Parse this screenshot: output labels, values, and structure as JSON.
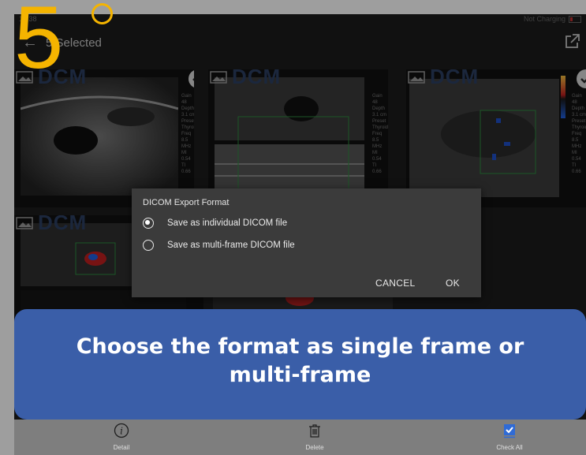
{
  "status": {
    "time": "10:38",
    "battery_text": "Not Charging"
  },
  "header": {
    "selected_label": "5 Selected"
  },
  "thumbnails": {
    "watermark": "DCM",
    "side_info": "Gain\n48\nDepth\n3.1 cm\nPreset\nThyroid\nFreq\n8.5\nMHz\nMI\n0.54\nTI\n0.66"
  },
  "dialog": {
    "title": "DICOM Export Format",
    "options": [
      {
        "label": "Save as individual DICOM file",
        "selected": true
      },
      {
        "label": "Save as multi-frame DICOM file",
        "selected": false
      }
    ],
    "cancel_label": "CANCEL",
    "ok_label": "OK"
  },
  "banner": {
    "text": "Choose the format as single frame or\nmulti-frame"
  },
  "toolbar": {
    "detail_label": "Detail",
    "delete_label": "Delete",
    "check_all_label": "Check All"
  },
  "step": {
    "number": "5"
  },
  "colors": {
    "accent": "#f5b400",
    "banner": "#3a5ea8",
    "dialog_bg": "#3b3b3b",
    "toolbar_bg": "#7e7e7e",
    "check_blue": "#2f6bd6"
  }
}
